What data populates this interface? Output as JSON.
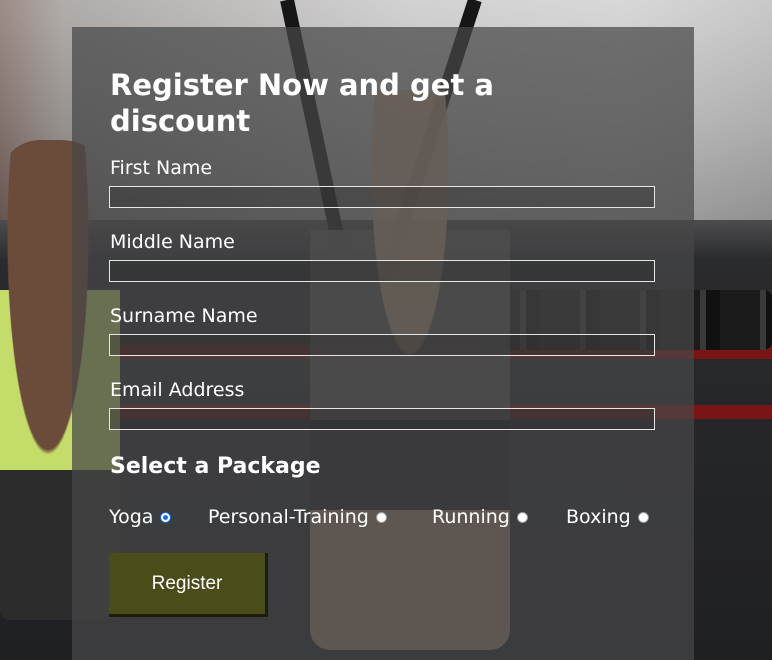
{
  "form": {
    "title": "Register Now and get a discount",
    "fields": [
      {
        "label": "First Name",
        "value": "",
        "placeholder": ""
      },
      {
        "label": "Middle Name",
        "value": "",
        "placeholder": ""
      },
      {
        "label": "Surname Name",
        "value": "",
        "placeholder": ""
      },
      {
        "label": "Email Address",
        "value": "",
        "placeholder": ""
      }
    ],
    "package_heading": "Select a Package",
    "packages": [
      {
        "label": "Yoga",
        "selected": true
      },
      {
        "label": "Personal-Training",
        "selected": false
      },
      {
        "label": "Running",
        "selected": false
      },
      {
        "label": "Boxing",
        "selected": false
      }
    ],
    "submit_label": "Register"
  },
  "colors": {
    "card_overlay": "#464648",
    "button_bg": "#4a4c1a",
    "radio_selected": "#1a6ce8",
    "text": "#ffffff"
  },
  "icons": {
    "background": "gym-photo-background"
  }
}
